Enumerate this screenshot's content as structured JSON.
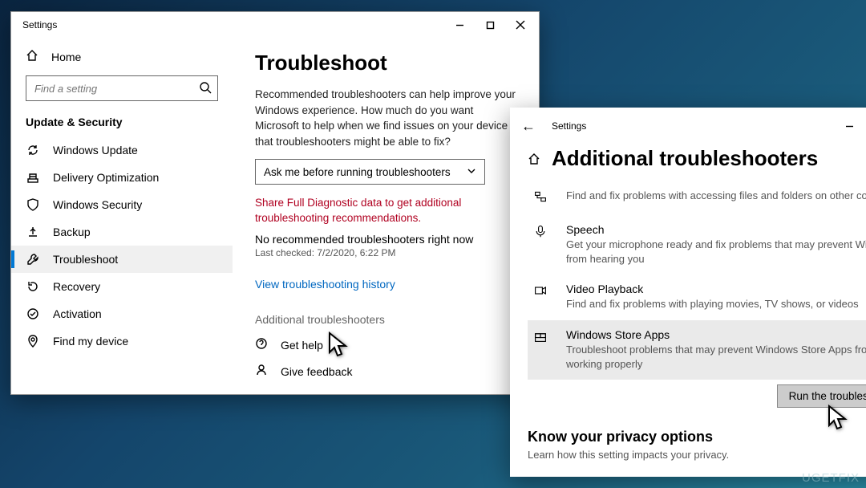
{
  "window1": {
    "title": "Settings",
    "home": "Home",
    "search_placeholder": "Find a setting",
    "section": "Update & Security",
    "sidebar": [
      {
        "label": "Windows Update",
        "icon": "sync"
      },
      {
        "label": "Delivery Optimization",
        "icon": "delivery"
      },
      {
        "label": "Windows Security",
        "icon": "shield"
      },
      {
        "label": "Backup",
        "icon": "backup"
      },
      {
        "label": "Troubleshoot",
        "icon": "wrench",
        "selected": true
      },
      {
        "label": "Recovery",
        "icon": "recovery"
      },
      {
        "label": "Activation",
        "icon": "activation"
      },
      {
        "label": "Find my device",
        "icon": "find"
      }
    ],
    "heading": "Troubleshoot",
    "description": "Recommended troubleshooters can help improve your Windows experience. How much do you want Microsoft to help when we find issues on your device that troubleshooters might be able to fix?",
    "dropdown_value": "Ask me before running troubleshooters",
    "diag_link": "Share Full Diagnostic data to get additional troubleshooting recommendations.",
    "no_rec": "No recommended troubleshooters right now",
    "last_checked": "Last checked: 7/2/2020, 6:22 PM",
    "history_link": "View troubleshooting history",
    "additional_link": "Additional troubleshooters",
    "get_help": "Get help",
    "give_feedback": "Give feedback"
  },
  "window2": {
    "title": "Settings",
    "heading": "Additional troubleshooters",
    "items": [
      {
        "title_suffix": "",
        "icon": "network",
        "desc": "Find and fix problems with accessing files and folders on other computers."
      },
      {
        "title": "Speech",
        "icon": "mic",
        "desc": "Get your microphone ready and fix problems that may prevent Windows from hearing you"
      },
      {
        "title": "Video Playback",
        "icon": "video",
        "desc": "Find and fix problems with playing movies, TV shows, or videos"
      },
      {
        "title": "Windows Store Apps",
        "icon": "store",
        "desc": "Troubleshoot problems that may prevent Windows Store Apps from working properly",
        "selected": true
      }
    ],
    "run_button": "Run the troubleshooter",
    "privacy_heading": "Know your privacy options",
    "privacy_desc": "Learn how this setting impacts your privacy."
  },
  "watermark": "UGETFIX"
}
